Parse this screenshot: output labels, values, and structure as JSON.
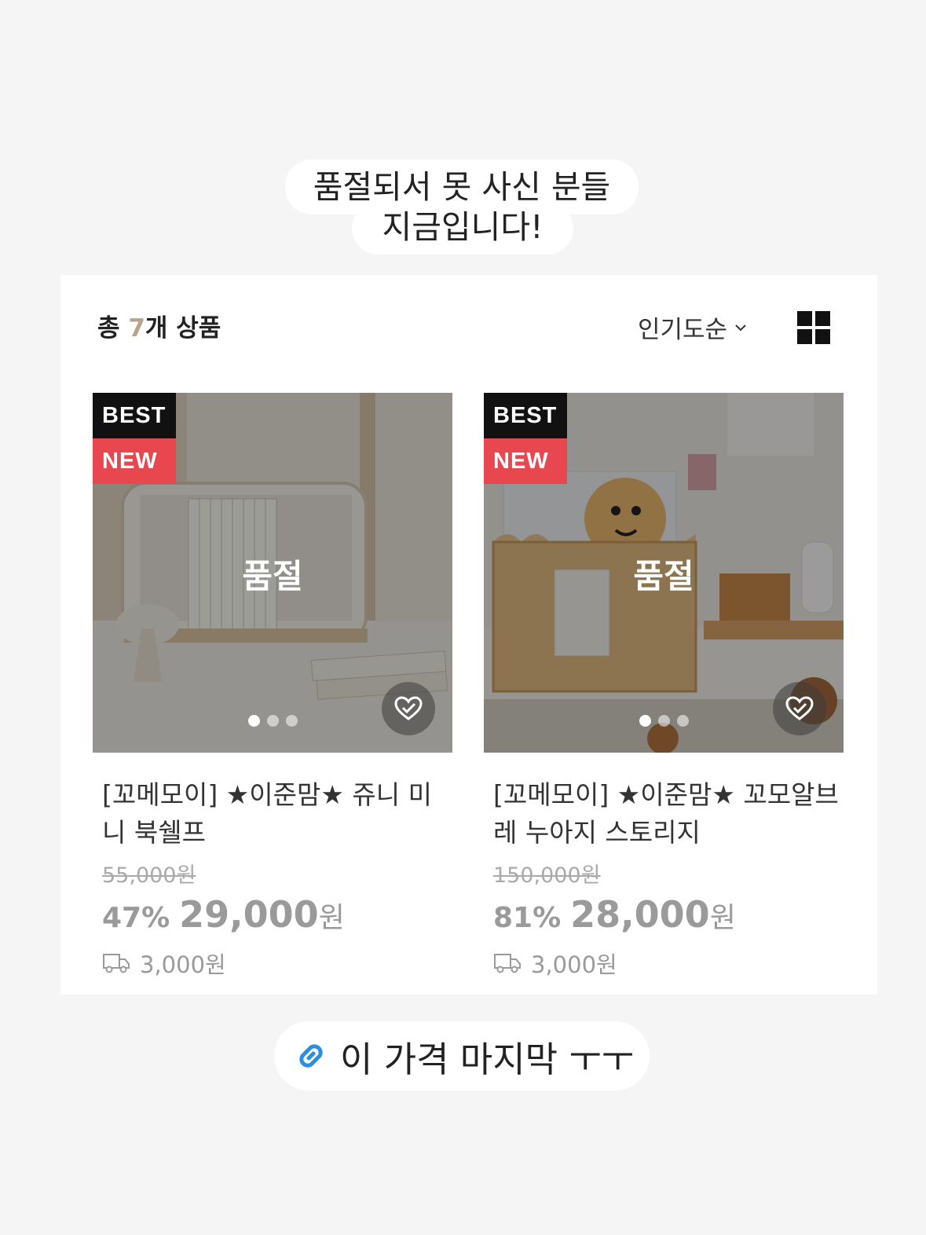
{
  "caption": {
    "line1": "품절되서 못 사신 분들",
    "line2": "지금입니다!"
  },
  "list_header": {
    "total_prefix": "총 ",
    "total_count": "7",
    "total_suffix": "개 상품",
    "sort_label": "인기도순",
    "view_toggle_icon": "grid-view-icon"
  },
  "products": [
    {
      "badge_best": "BEST",
      "badge_new": "NEW",
      "soldout_label": "품절",
      "title": "[꼬메모이] ★이준맘★ 쥬니 미니 북쉘프",
      "original_price": "55,000원",
      "discount": "47%",
      "sale_price": "29,000",
      "currency": "원",
      "shipping": "3,000원",
      "image_dots": 3,
      "active_dot": 0
    },
    {
      "badge_best": "BEST",
      "badge_new": "NEW",
      "soldout_label": "품절",
      "title": "[꼬메모이] ★이준맘★ 꼬모알브레 누아지 스토리지",
      "original_price": "150,000원",
      "discount": "81%",
      "sale_price": "28,000",
      "currency": "원",
      "shipping": "3,000원",
      "image_dots": 3,
      "active_dot": 0
    }
  ],
  "link_sticker": {
    "icon": "link-icon",
    "text": "이 가격 마지막 ㅜㅜ"
  },
  "colors": {
    "badge_best": "#111111",
    "badge_new": "#e8474f",
    "count_accent": "#b8a48c",
    "link_blue": "#2a8fe0"
  }
}
